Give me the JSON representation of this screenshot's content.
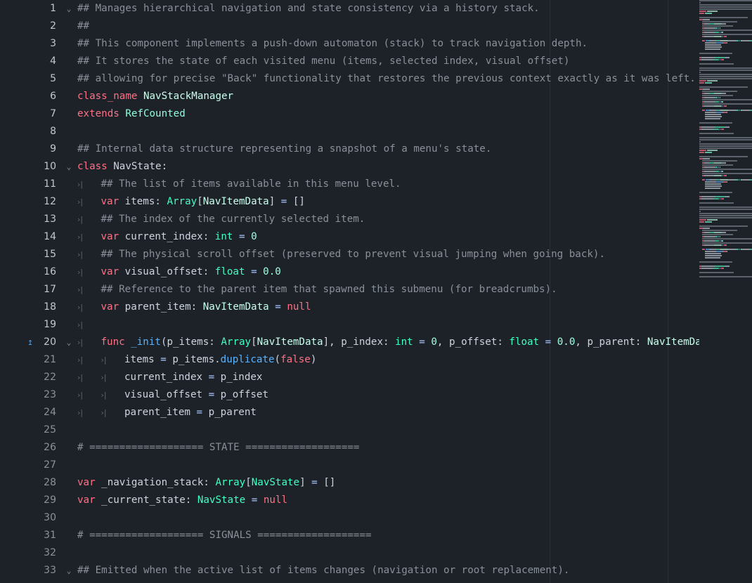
{
  "editor": {
    "language": "GDScript",
    "gutter_icons": [
      {
        "line": 20,
        "icon": "override-method-icon",
        "color": "#4a9ee8"
      }
    ],
    "lines": [
      {
        "n": 1,
        "fold": true,
        "tokens": [
          [
            "c",
            "## Manages hierarchical navigation and state consistency via a history stack."
          ]
        ]
      },
      {
        "n": 2,
        "tokens": [
          [
            "c",
            "##"
          ]
        ]
      },
      {
        "n": 3,
        "tokens": [
          [
            "c",
            "## This component implements a push-down automaton (stack) to track navigation depth."
          ]
        ]
      },
      {
        "n": 4,
        "tokens": [
          [
            "c",
            "## It stores the state of each visited menu (items, selected index, visual offset)"
          ]
        ]
      },
      {
        "n": 5,
        "tokens": [
          [
            "c",
            "## allowing for precise \"Back\" functionality that restores the previous context exactly as it was left."
          ]
        ]
      },
      {
        "n": 6,
        "tokens": [
          [
            "k",
            "class_name"
          ],
          [
            "p",
            " "
          ],
          [
            "tc",
            "NavStackManager"
          ]
        ]
      },
      {
        "n": 7,
        "tokens": [
          [
            "k",
            "extends"
          ],
          [
            "p",
            " "
          ],
          [
            "tb",
            "RefCounted"
          ]
        ]
      },
      {
        "n": 8,
        "tokens": []
      },
      {
        "n": 9,
        "tokens": [
          [
            "c",
            "## Internal data structure representing a snapshot of a menu's state."
          ]
        ]
      },
      {
        "n": 10,
        "fold": true,
        "tokens": [
          [
            "k",
            "class"
          ],
          [
            "p",
            " NavState:"
          ]
        ]
      },
      {
        "n": 11,
        "indent": 1,
        "tokens": [
          [
            "c",
            "## The list of items available in this menu level."
          ]
        ]
      },
      {
        "n": 12,
        "indent": 1,
        "tokens": [
          [
            "k",
            "var"
          ],
          [
            "p",
            " items: "
          ],
          [
            "t",
            "Array"
          ],
          [
            "p",
            "["
          ],
          [
            "tc",
            "NavItemData"
          ],
          [
            "p",
            "] "
          ],
          [
            "o",
            "="
          ],
          [
            "p",
            " []"
          ]
        ]
      },
      {
        "n": 13,
        "indent": 1,
        "tokens": [
          [
            "c",
            "## The index of the currently selected item."
          ]
        ]
      },
      {
        "n": 14,
        "indent": 1,
        "tokens": [
          [
            "k",
            "var"
          ],
          [
            "p",
            " current_index: "
          ],
          [
            "t",
            "int"
          ],
          [
            "p",
            " "
          ],
          [
            "o",
            "="
          ],
          [
            "p",
            " "
          ],
          [
            "n",
            "0"
          ]
        ]
      },
      {
        "n": 15,
        "indent": 1,
        "tokens": [
          [
            "c",
            "## The physical scroll offset (preserved to prevent visual jumping when going back)."
          ]
        ]
      },
      {
        "n": 16,
        "indent": 1,
        "tokens": [
          [
            "k",
            "var"
          ],
          [
            "p",
            " visual_offset: "
          ],
          [
            "t",
            "float"
          ],
          [
            "p",
            " "
          ],
          [
            "o",
            "="
          ],
          [
            "p",
            " "
          ],
          [
            "n",
            "0.0"
          ]
        ]
      },
      {
        "n": 17,
        "indent": 1,
        "tokens": [
          [
            "c",
            "## Reference to the parent item that spawned this submenu (for breadcrumbs)."
          ]
        ]
      },
      {
        "n": 18,
        "indent": 1,
        "tokens": [
          [
            "k",
            "var"
          ],
          [
            "p",
            " parent_item: "
          ],
          [
            "tc",
            "NavItemData"
          ],
          [
            "p",
            " "
          ],
          [
            "o",
            "="
          ],
          [
            "p",
            " "
          ],
          [
            "k",
            "null"
          ]
        ]
      },
      {
        "n": 19,
        "indent": 1,
        "tokens": []
      },
      {
        "n": 20,
        "indent": 1,
        "fold": true,
        "tokens": [
          [
            "k",
            "func"
          ],
          [
            "p",
            " "
          ],
          [
            "f",
            "_init"
          ],
          [
            "p",
            "(p_items: "
          ],
          [
            "t",
            "Array"
          ],
          [
            "p",
            "["
          ],
          [
            "tc",
            "NavItemData"
          ],
          [
            "p",
            "], p_index: "
          ],
          [
            "t",
            "int"
          ],
          [
            "p",
            " "
          ],
          [
            "o",
            "="
          ],
          [
            "p",
            " "
          ],
          [
            "n",
            "0"
          ],
          [
            "p",
            ", p_offset: "
          ],
          [
            "t",
            "float"
          ],
          [
            "p",
            " "
          ],
          [
            "o",
            "="
          ],
          [
            "p",
            " "
          ],
          [
            "n",
            "0.0"
          ],
          [
            "p",
            ", p_parent: "
          ],
          [
            "tc",
            "NavItemDat"
          ]
        ]
      },
      {
        "n": 21,
        "indent": 2,
        "tokens": [
          [
            "p",
            "items "
          ],
          [
            "o",
            "="
          ],
          [
            "p",
            " p_items."
          ],
          [
            "f",
            "duplicate"
          ],
          [
            "p",
            "("
          ],
          [
            "k",
            "false"
          ],
          [
            "p",
            ")"
          ]
        ]
      },
      {
        "n": 22,
        "indent": 2,
        "tokens": [
          [
            "p",
            "current_index "
          ],
          [
            "o",
            "="
          ],
          [
            "p",
            " p_index"
          ]
        ]
      },
      {
        "n": 23,
        "indent": 2,
        "tokens": [
          [
            "p",
            "visual_offset "
          ],
          [
            "o",
            "="
          ],
          [
            "p",
            " p_offset"
          ]
        ]
      },
      {
        "n": 24,
        "indent": 2,
        "tokens": [
          [
            "p",
            "parent_item "
          ],
          [
            "o",
            "="
          ],
          [
            "p",
            " p_parent"
          ]
        ]
      },
      {
        "n": 25,
        "tokens": []
      },
      {
        "n": 26,
        "tokens": [
          [
            "c",
            "# =================== STATE ==================="
          ]
        ]
      },
      {
        "n": 27,
        "tokens": []
      },
      {
        "n": 28,
        "tokens": [
          [
            "k",
            "var"
          ],
          [
            "p",
            " _navigation_stack: "
          ],
          [
            "t",
            "Array"
          ],
          [
            "p",
            "["
          ],
          [
            "t",
            "NavState"
          ],
          [
            "p",
            "] "
          ],
          [
            "o",
            "="
          ],
          [
            "p",
            " []"
          ]
        ]
      },
      {
        "n": 29,
        "tokens": [
          [
            "k",
            "var"
          ],
          [
            "p",
            " _current_state: "
          ],
          [
            "t",
            "NavState"
          ],
          [
            "p",
            " "
          ],
          [
            "o",
            "="
          ],
          [
            "p",
            " "
          ],
          [
            "k",
            "null"
          ]
        ]
      },
      {
        "n": 30,
        "tokens": []
      },
      {
        "n": 31,
        "tokens": [
          [
            "c",
            "# =================== SIGNALS ==================="
          ]
        ]
      },
      {
        "n": 32,
        "tokens": []
      },
      {
        "n": 33,
        "fold": true,
        "tokens": [
          [
            "c",
            "## Emitted when the active list of items changes (navigation or root replacement)."
          ]
        ]
      }
    ]
  }
}
